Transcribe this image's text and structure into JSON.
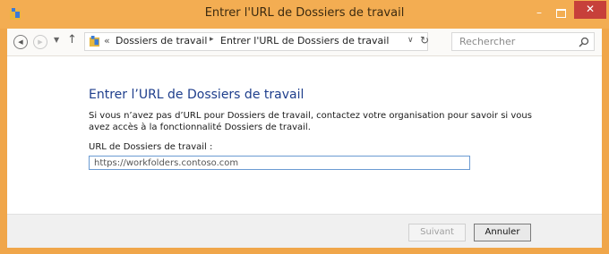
{
  "window": {
    "title": "Entrer l'URL de Dossiers de travail",
    "minimize_label": "–",
    "close_label": "✕",
    "accent_color": "#f3ad52",
    "close_color": "#c7403a"
  },
  "navbar": {
    "back_icon": "◀",
    "forward_icon": "▶",
    "recent_icon": "▼",
    "up_icon": "↑",
    "overflow": "«",
    "breadcrumb": [
      "Dossiers de travail",
      "Entrer l'URL de Dossiers de travail"
    ],
    "breadcrumb_sep": "▸",
    "dropdown_icon": "∨",
    "refresh_icon": "↻",
    "search_placeholder": "Rechercher"
  },
  "main": {
    "heading": "Entrer l’URL de Dossiers de travail",
    "description": "Si vous n’avez pas d’URL pour Dossiers de travail, contactez votre organisation pour savoir si vous avez accès à la fonctionnalité Dossiers de travail.",
    "field_label": "URL de Dossiers de travail :",
    "field_value": "https://workfolders.contoso.com"
  },
  "footer": {
    "next_label": "Suivant",
    "cancel_label": "Annuler"
  }
}
